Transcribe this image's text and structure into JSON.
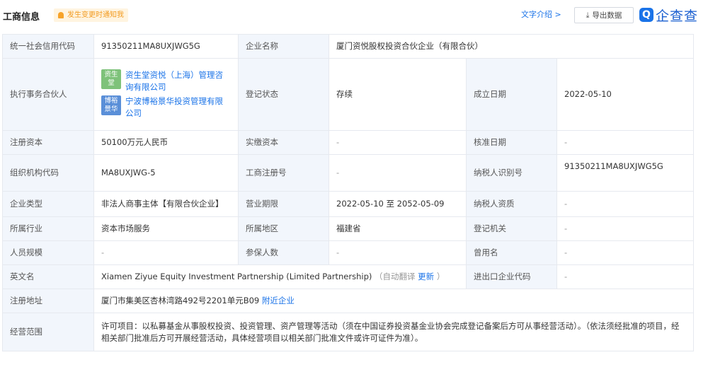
{
  "header": {
    "title": "工商信息",
    "notify_label": "发生变更时通知我",
    "text_intro": "文字介绍 >",
    "export_label": "导出数据",
    "brand_mark": "Q",
    "brand_name": "企查查"
  },
  "labels": {
    "credit_code": "统一社会信用代码",
    "company_name": "企业名称",
    "partner": "执行事务合伙人",
    "reg_status": "登记状态",
    "found_date": "成立日期",
    "reg_capital": "注册资本",
    "paid_capital": "实缴资本",
    "approve_date": "核准日期",
    "org_code": "组织机构代码",
    "biz_reg_no": "工商注册号",
    "taxpayer_id": "纳税人识别号",
    "company_type": "企业类型",
    "biz_term": "营业期限",
    "taxpayer_qual": "纳税人资质",
    "industry": "所属行业",
    "region": "所属地区",
    "reg_authority": "登记机关",
    "staff_size": "人员规模",
    "insured": "参保人数",
    "former_name": "曾用名",
    "english_name": "英文名",
    "import_export_code": "进出口企业代码",
    "reg_address": "注册地址",
    "scope": "经营范围"
  },
  "values": {
    "credit_code": "91350211MA8UXJWG5G",
    "company_name": "厦门资悦股权投资合伙企业（有限合伙）",
    "partners": [
      {
        "logo": "资生堂",
        "name": "资生堂资悦（上海）管理咨询有限公司"
      },
      {
        "logo": "博裕景华",
        "name": "宁波博裕景华投资管理有限公司"
      }
    ],
    "reg_status": "存续",
    "found_date": "2022-05-10",
    "reg_capital": "50100万元人民币",
    "paid_capital": "-",
    "approve_date": "-",
    "org_code": "MA8UXJWG-5",
    "biz_reg_no": "-",
    "taxpayer_id": "91350211MA8UXJWG5G",
    "company_type": "非法人商事主体【有限合伙企业】",
    "biz_term": "2022-05-10 至 2052-05-09",
    "taxpayer_qual": "-",
    "industry": "资本市场服务",
    "region": "福建省",
    "reg_authority": "-",
    "staff_size": "-",
    "insured": "-",
    "former_name": "-",
    "english_name": "Xiamen Ziyue Equity Investment Partnership (Limited Partnership)",
    "auto_translate_open": "（自动翻译",
    "auto_translate_update": "更新",
    "auto_translate_close": "）",
    "import_export_code": "-",
    "reg_address": "厦门市集美区杏林湾路492号2201单元B09",
    "nearby_link": "附近企业",
    "scope": "许可项目：以私募基金从事股权投资、投资管理、资产管理等活动（须在中国证券投资基金业协会完成登记备案后方可从事经营活动）。（依法须经批准的项目，经相关部门批准后方可开展经营活动，具体经营项目以相关部门批准文件或许可证件为准）。"
  },
  "colors": {
    "accent": "#1a73e8",
    "label_bg": "#f2f6fc",
    "border": "#e6e9ef",
    "notify_bg": "#fff4e0",
    "notify_fg": "#f29a1f"
  }
}
